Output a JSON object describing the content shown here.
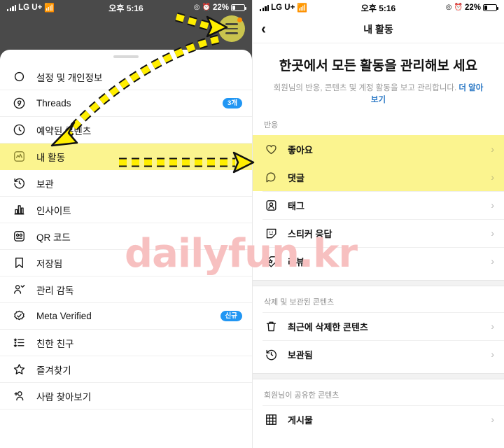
{
  "colors": {
    "highlight_yellow": "#fbf48f",
    "arrow_yellow": "#ffee00",
    "badge_blue": "#2196f3",
    "link_blue": "#2d7ac6",
    "watermark_pink": "#f7c0c0",
    "burger_circle": "#c9c44e",
    "badge_dot_orange": "#ff8a00"
  },
  "status_bar": {
    "carrier": "LG U+",
    "time": "오후 5:16",
    "battery_percent": "22%",
    "signal_icon": "signal-bars-icon",
    "wifi_icon": "wifi-icon",
    "location_icon": "location-icon",
    "alarm_icon": "alarm-clock-icon",
    "battery_icon": "battery-icon"
  },
  "left_panel": {
    "hamburger_button": "hamburger-menu-button",
    "grabber": "sheet-drag-handle",
    "menu_items": [
      {
        "label": "설정 및 개인정보",
        "icon": "gear-icon",
        "badge": null,
        "highlighted": false
      },
      {
        "label": "Threads",
        "icon": "threads-icon",
        "badge": "3개",
        "highlighted": false
      },
      {
        "label": "예약된 콘텐츠",
        "icon": "clock-icon",
        "badge": null,
        "highlighted": false
      },
      {
        "label": "내 활동",
        "icon": "activity-chart-icon",
        "badge": null,
        "highlighted": true
      },
      {
        "label": "보관",
        "icon": "archive-clock-icon",
        "badge": null,
        "highlighted": false
      },
      {
        "label": "인사이트",
        "icon": "bar-chart-icon",
        "badge": null,
        "highlighted": false
      },
      {
        "label": "QR 코드",
        "icon": "qr-code-icon",
        "badge": null,
        "highlighted": false
      },
      {
        "label": "저장됨",
        "icon": "bookmark-icon",
        "badge": null,
        "highlighted": false
      },
      {
        "label": "관리 감독",
        "icon": "supervision-people-icon",
        "badge": null,
        "highlighted": false
      },
      {
        "label": "Meta Verified",
        "icon": "verified-badge-icon",
        "badge": "신규",
        "highlighted": false
      },
      {
        "label": "친한 친구",
        "icon": "close-friends-list-icon",
        "badge": null,
        "highlighted": false
      },
      {
        "label": "즐겨찾기",
        "icon": "star-icon",
        "badge": null,
        "highlighted": false
      },
      {
        "label": "사람 찾아보기",
        "icon": "add-person-icon",
        "badge": null,
        "highlighted": false
      }
    ]
  },
  "right_panel": {
    "back_button": "back-chevron-icon",
    "nav_title": "내 활동",
    "hero_title": "한곳에서 모든 활동을 관리해보 세요",
    "hero_desc": "회원님의 반응, 콘텐츠 및 계정 활동을 보고 관리합니다. ",
    "hero_link": "더 알아보기",
    "sections": [
      {
        "heading": "반응",
        "rows": [
          {
            "label": "좋아요",
            "icon": "heart-icon",
            "highlighted": true
          },
          {
            "label": "댓글",
            "icon": "comment-bubble-icon",
            "highlighted": true
          },
          {
            "label": "태그",
            "icon": "tag-person-icon",
            "highlighted": false
          },
          {
            "label": "스티커 응답",
            "icon": "sticker-face-icon",
            "highlighted": false
          },
          {
            "label": "리뷰",
            "icon": "review-tag-icon",
            "highlighted": false
          }
        ]
      },
      {
        "heading": "삭제 및 보관된 콘텐츠",
        "rows": [
          {
            "label": "최근에 삭제한 콘텐츠",
            "icon": "trash-icon",
            "highlighted": false
          },
          {
            "label": "보관됨",
            "icon": "archive-clock-icon",
            "highlighted": false
          }
        ]
      },
      {
        "heading": "회원님이 공유한 콘텐츠",
        "rows": [
          {
            "label": "게시물",
            "icon": "grid-posts-icon",
            "highlighted": false
          }
        ]
      }
    ],
    "chevron": "›"
  },
  "annotations": {
    "curved_arrow": "dashed-curved-arrow",
    "straight_arrow": "dashed-straight-arrow",
    "short_arrow": "dashed-short-arrow-to-hamburger"
  },
  "watermark": {
    "text": "dailyfun.kr"
  }
}
